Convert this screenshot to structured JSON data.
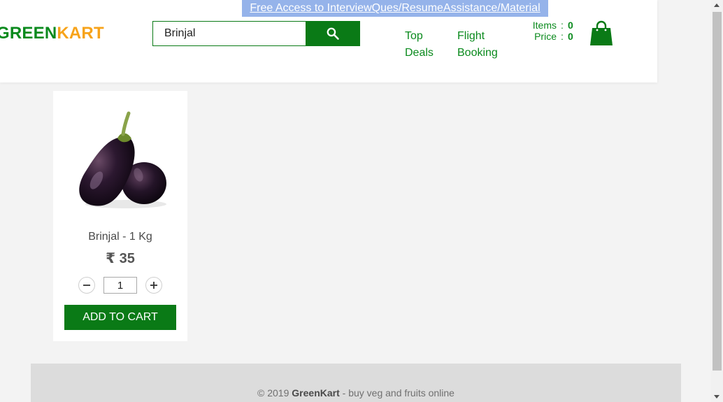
{
  "header": {
    "promo_link": "Free Access to InterviewQues/ResumeAssistance/Material",
    "brand_part1": "GREEN",
    "brand_part2": "KART",
    "search": {
      "value": "Brinjal"
    },
    "nav": [
      {
        "line1": "Top",
        "line2": "Deals"
      },
      {
        "line1": "Flight",
        "line2": "Booking"
      }
    ],
    "cart": {
      "items_label": "Items",
      "items_value": "0",
      "price_label": "Price",
      "price_value": "0",
      "separator": ":"
    }
  },
  "product": {
    "name": "Brinjal - 1 Kg",
    "price": "₹ 35",
    "quantity": "1",
    "add_label": "ADD TO CART"
  },
  "footer": {
    "copyright": "© 2019",
    "brand": "GreenKart",
    "tagline": "- buy veg and fruits online"
  },
  "colors": {
    "brand_green": "#0a7a16",
    "brand_orange": "#f7a31a",
    "promo_bg": "#95b3ea"
  }
}
